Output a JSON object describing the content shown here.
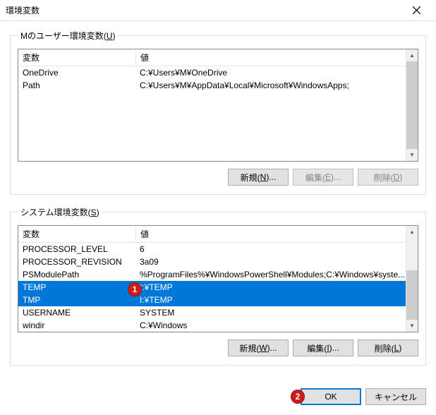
{
  "window": {
    "title": "環境変数"
  },
  "userSection": {
    "legend_pre": "Mのユーザー環境変数(",
    "legend_u": "U",
    "legend_post": ")",
    "headers": {
      "name": "変数",
      "value": "値"
    },
    "rows": [
      {
        "name": "OneDrive",
        "value": "C:¥Users¥M¥OneDrive"
      },
      {
        "name": "Path",
        "value": "C:¥Users¥M¥AppData¥Local¥Microsoft¥WindowsApps;"
      }
    ],
    "buttons": {
      "new_pre": "新規(",
      "new_u": "N",
      "new_post": ")...",
      "edit_pre": "編集(",
      "edit_u": "E",
      "edit_post": ")...",
      "del_pre": "削除(",
      "del_u": "D",
      "del_post": ")"
    }
  },
  "systemSection": {
    "legend_pre": "システム環境変数(",
    "legend_u": "S",
    "legend_post": ")",
    "headers": {
      "name": "変数",
      "value": "値"
    },
    "rows": [
      {
        "name": "PROCESSOR_LEVEL",
        "value": "6"
      },
      {
        "name": "PROCESSOR_REVISION",
        "value": "3a09"
      },
      {
        "name": "PSModulePath",
        "value": "%ProgramFiles%¥WindowsPowerShell¥Modules;C:¥Windows¥syste..."
      },
      {
        "name": "TEMP",
        "value": "I:¥TEMP",
        "selected": true
      },
      {
        "name": "TMP",
        "value": "I:¥TEMP",
        "selected": true
      },
      {
        "name": "USERNAME",
        "value": "SYSTEM"
      },
      {
        "name": "windir",
        "value": "C:¥Windows"
      }
    ],
    "buttons": {
      "new_pre": "新規(",
      "new_u": "W",
      "new_post": ")...",
      "edit_pre": "編集(",
      "edit_u": "I",
      "edit_post": ")...",
      "del_pre": "削除(",
      "del_u": "L",
      "del_post": ")"
    }
  },
  "footer": {
    "ok": "OK",
    "cancel": "キャンセル"
  },
  "annotations": {
    "a1": "1",
    "a2": "2"
  }
}
